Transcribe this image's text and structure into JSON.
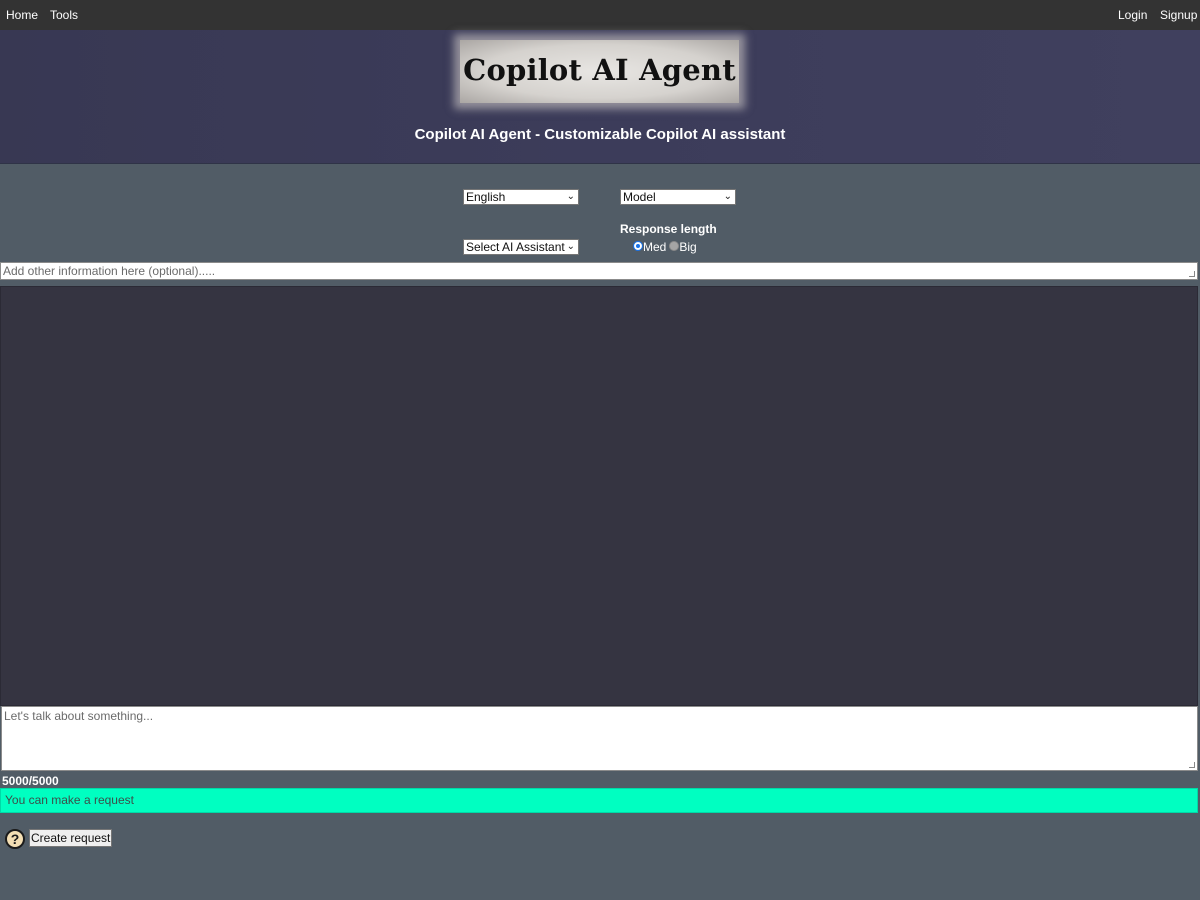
{
  "topnav": {
    "home": "Home",
    "tools": "Tools",
    "login": "Login",
    "signup": "Signup"
  },
  "header": {
    "logo_text": "Copilot AI Agent",
    "subtitle": "Copilot AI Agent - Customizable Copilot AI assistant"
  },
  "controls": {
    "language_selected": "English",
    "model_selected": "Model",
    "assistant_selected": "Select AI Assistant",
    "response_length_label": "Response length",
    "options": {
      "med": "Med",
      "big": "Big"
    },
    "selected_option": "Med"
  },
  "inputs": {
    "info_placeholder": "Add other information here (optional).....",
    "message_placeholder": "Let's talk about something..."
  },
  "counter": "5000/5000",
  "status": "You can make a request",
  "buttons": {
    "help": "?",
    "create": "Create request"
  },
  "icons": {
    "select_chevron": "chevron-down-icon",
    "help": "question-mark-icon"
  },
  "colors": {
    "status_bg": "#00ffc1",
    "header_bg": "#3c3c5a",
    "chat_bg": "#353441",
    "page_bg": "#515c66"
  }
}
